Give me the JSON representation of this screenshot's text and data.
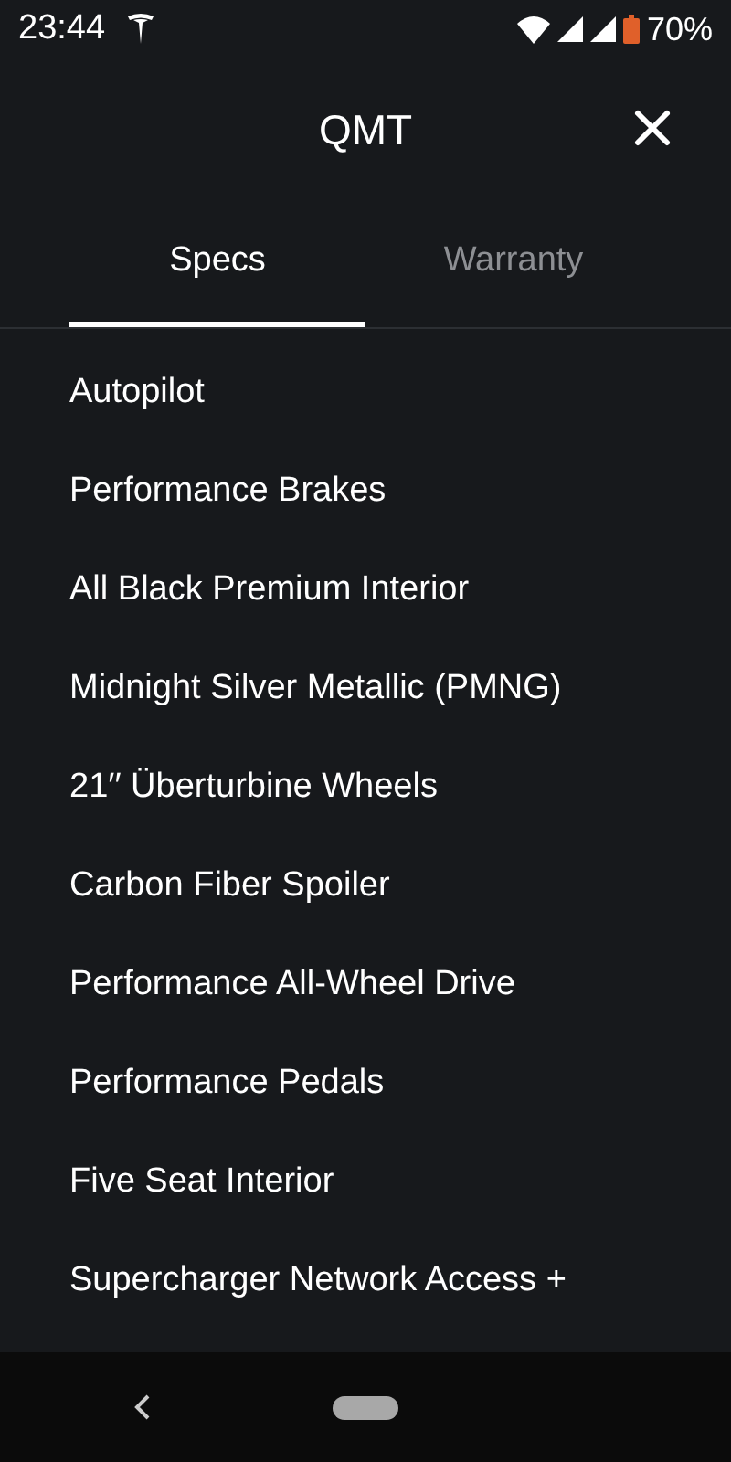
{
  "status_bar": {
    "time": "23:44",
    "battery": "70%"
  },
  "header": {
    "title": "QMT"
  },
  "tabs": [
    {
      "label": "Specs",
      "selected": true
    },
    {
      "label": "Warranty",
      "selected": false
    }
  ],
  "specs": [
    "Autopilot",
    "Performance Brakes",
    "All Black Premium Interior",
    "Midnight Silver Metallic (PMNG)",
    "21′′ Überturbine Wheels",
    "Carbon Fiber Spoiler",
    "Performance All-Wheel Drive",
    "Performance Pedals",
    "Five Seat Interior",
    "Supercharger Network Access +"
  ]
}
